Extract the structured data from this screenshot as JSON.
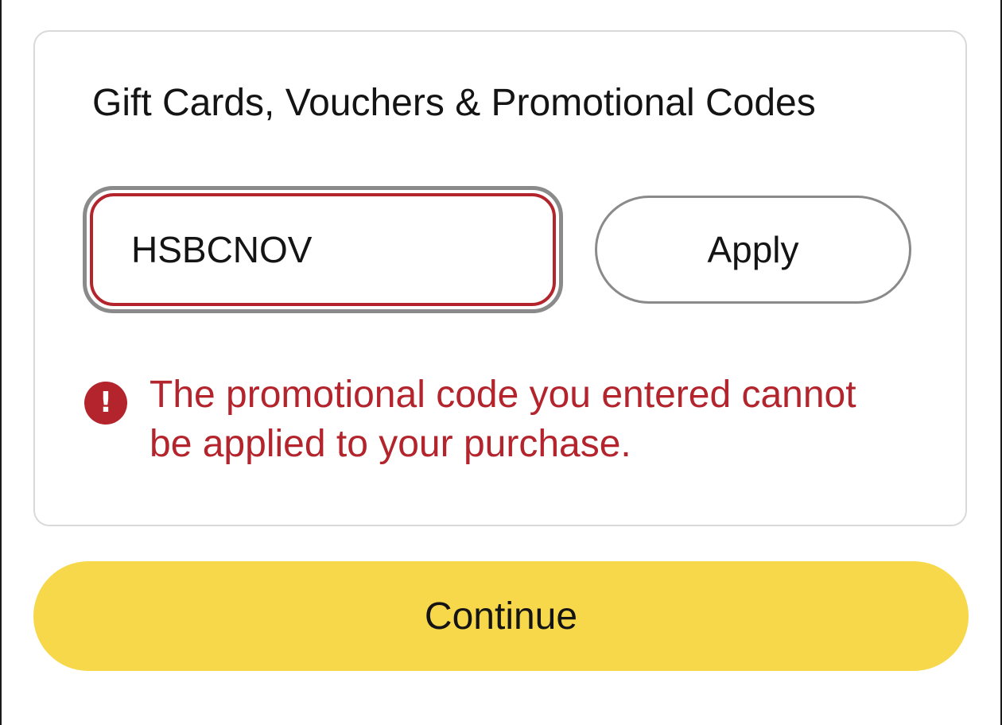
{
  "promo": {
    "title": "Gift Cards, Vouchers & Promotional Codes",
    "code_value": "HSBCNOV",
    "apply_label": "Apply",
    "error": {
      "icon": "error-exclamation-icon",
      "message": "The promotional code you entered cannot be applied to your purchase."
    }
  },
  "footer": {
    "continue_label": "Continue"
  },
  "colors": {
    "error": "#b3242c",
    "primary_button": "#f7d84a",
    "card_border": "#d9d9d9",
    "neutral_border": "#8a8a8a"
  }
}
